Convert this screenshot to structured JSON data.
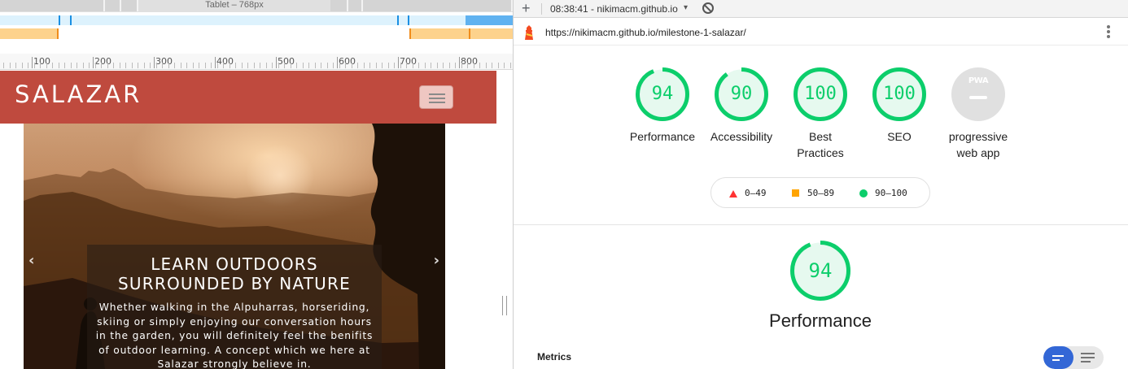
{
  "devtools": {
    "media_query_label": "Tablet – 768px",
    "ruler_labels": [
      "100",
      "200",
      "300",
      "400",
      "500",
      "600",
      "700",
      "800"
    ]
  },
  "site": {
    "brand": "SALAZAR",
    "carousel": {
      "prev_icon": "‹",
      "next_icon": "›",
      "title_line1": "LEARN OUTDOORS",
      "title_line2": "SURROUNDED BY NATURE",
      "text": "Whether walking in the Alpuharras, horseriding, skiing or simply enjoying our conversation hours in the garden, you will definitely feel the benifits of outdoor learning. A concept which we here at Salazar strongly believe in."
    }
  },
  "lighthouse": {
    "toolbar": {
      "add_icon": "+",
      "report_label": "08:38:41 - nikimacm.github.io",
      "dropdown_icon": "▾"
    },
    "url": "https://nikimacm.github.io/milestone-1-salazar/",
    "scores": [
      {
        "label_line1": "Performance",
        "label_line2": "",
        "value": "94",
        "fraction": 0.94
      },
      {
        "label_line1": "Accessibility",
        "label_line2": "",
        "value": "90",
        "fraction": 0.9
      },
      {
        "label_line1": "Best",
        "label_line2": "Practices",
        "value": "100",
        "fraction": 1.0
      },
      {
        "label_line1": "SEO",
        "label_line2": "",
        "value": "100",
        "fraction": 1.0
      }
    ],
    "pwa": {
      "badge": "PWA",
      "label_line1": "progressive",
      "label_line2": "web app"
    },
    "legend": [
      {
        "shape": "triangle",
        "range": "0–49",
        "color": "#ff3333"
      },
      {
        "shape": "square",
        "range": "50–89",
        "color": "#ffa400"
      },
      {
        "shape": "circle",
        "range": "90–100",
        "color": "#0cce6b"
      }
    ],
    "category": {
      "title": "Performance",
      "value": "94",
      "fraction": 0.94
    },
    "metrics_label": "Metrics",
    "colors": {
      "pass": "#0cce6b",
      "pass_bg": "#e6f9ef",
      "toggle_active": "#3367d6"
    }
  }
}
